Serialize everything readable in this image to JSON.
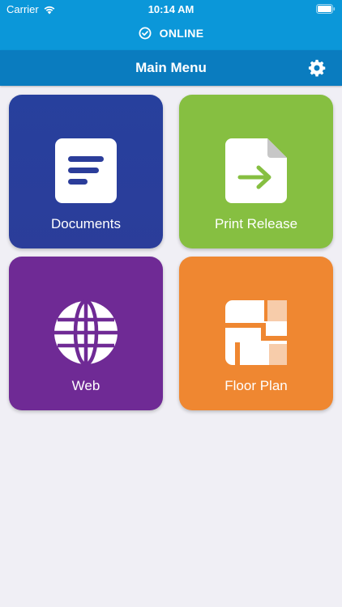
{
  "status_bar": {
    "carrier": "Carrier",
    "time": "10:14 AM"
  },
  "connection": {
    "status": "ONLINE"
  },
  "nav": {
    "title": "Main Menu"
  },
  "tiles": [
    {
      "label": "Documents",
      "icon": "documents-icon",
      "color": "#27409d"
    },
    {
      "label": "Print Release",
      "icon": "print-release-icon",
      "color": "#86bf41"
    },
    {
      "label": "Web",
      "icon": "globe-icon",
      "color": "#6f2a95"
    },
    {
      "label": "Floor Plan",
      "icon": "floor-plan-icon",
      "color": "#ef8731"
    }
  ],
  "colors": {
    "header_top": "#0b97d9",
    "header_nav": "#0a7cbf",
    "background": "#f0eff5"
  }
}
